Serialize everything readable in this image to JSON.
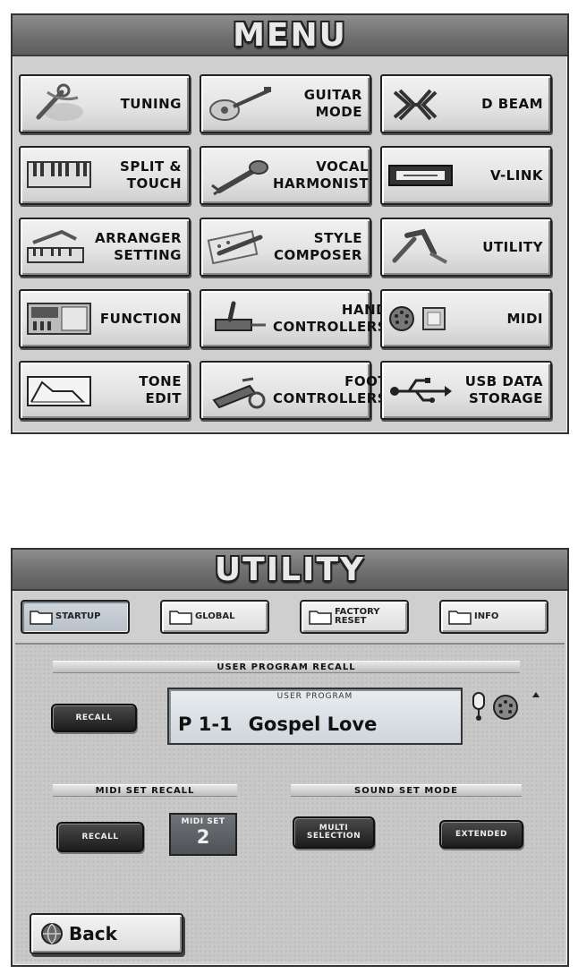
{
  "menu": {
    "title": "MENU",
    "buttons": [
      {
        "label": "TUNING",
        "icon": "tuning-wrench-icon"
      },
      {
        "label": "GUITAR\nMODE",
        "icon": "guitar-icon"
      },
      {
        "label": "D BEAM",
        "icon": "d-beam-icon"
      },
      {
        "label": "SPLIT &\nTOUCH",
        "icon": "keyboard-icon"
      },
      {
        "label": "VOCAL\nHARMONIST",
        "icon": "microphone-icon"
      },
      {
        "label": "V-LINK",
        "icon": "v-link-icon"
      },
      {
        "label": "ARRANGER\nSETTING",
        "icon": "arranger-icon"
      },
      {
        "label": "STYLE\nCOMPOSER",
        "icon": "style-composer-icon"
      },
      {
        "label": "UTILITY",
        "icon": "utility-tools-icon"
      },
      {
        "label": "FUNCTION",
        "icon": "function-icon"
      },
      {
        "label": "HAND\nCONTROLLERS",
        "icon": "hand-controller-icon"
      },
      {
        "label": "MIDI",
        "icon": "midi-icon"
      },
      {
        "label": "TONE\nEDIT",
        "icon": "tone-edit-icon"
      },
      {
        "label": "FOOT\nCONTROLLERS",
        "icon": "foot-controller-icon"
      },
      {
        "label": "USB DATA\nSTORAGE",
        "icon": "usb-icon"
      }
    ]
  },
  "utility": {
    "title": "UTILITY",
    "tabs": [
      {
        "label": "STARTUP",
        "active": true
      },
      {
        "label": "GLOBAL",
        "active": false
      },
      {
        "label": "FACTORY\nRESET",
        "active": false
      },
      {
        "label": "INFO",
        "active": false
      }
    ],
    "user_program_recall": {
      "header": "USER PROGRAM RECALL",
      "recall_button": "RECALL",
      "caption": "USER PROGRAM",
      "number": "P 1-1",
      "name": "Gospel Love"
    },
    "midi_set_recall": {
      "header": "MIDI SET RECALL",
      "recall_button": "RECALL",
      "caption": "MIDI SET",
      "value": "2"
    },
    "sound_set_mode": {
      "header": "SOUND SET MODE",
      "buttons": [
        "MULTI\nSELECTION",
        "EXTENDED"
      ]
    },
    "back_button": "Back"
  },
  "colors": {
    "panel_bg": "#cfcfcf",
    "title_bar": "#6f6f6f",
    "dark_button": "#2a2a2a",
    "lcd": "#d8dee3"
  }
}
